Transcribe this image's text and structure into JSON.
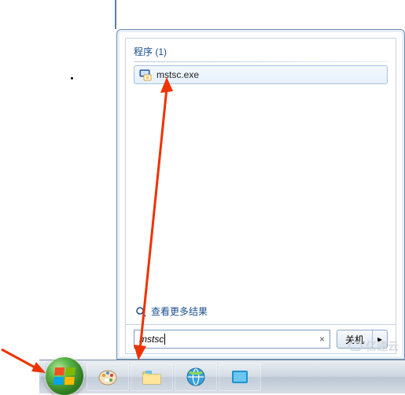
{
  "header": {
    "programs_label": "程序 (1)"
  },
  "result": {
    "name": "mstsc.exe",
    "icon": "mstsc-icon"
  },
  "more_results": {
    "label": "查看更多结果"
  },
  "search": {
    "value": "mstsc",
    "clear_glyph": "×"
  },
  "shutdown": {
    "label": "关机",
    "arrow": "▸"
  },
  "watermark": {
    "text": "亿速云"
  }
}
